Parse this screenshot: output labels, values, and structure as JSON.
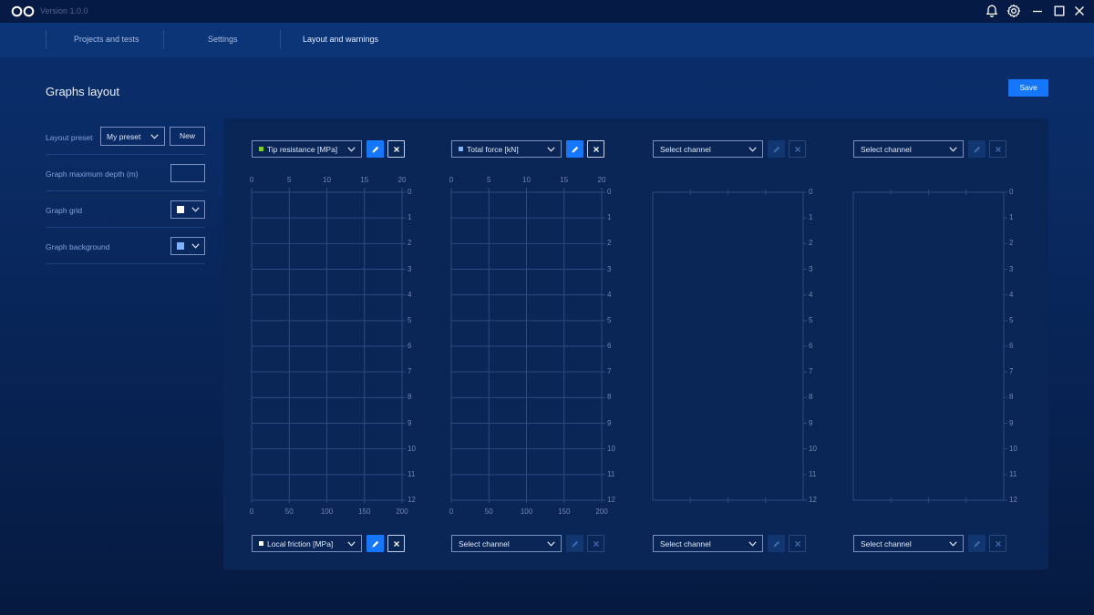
{
  "app": {
    "version": "Version 1.0.0"
  },
  "nav": {
    "items": [
      {
        "label": "Projects and tests"
      },
      {
        "label": "Settings"
      },
      {
        "label": "Layout and warnings"
      }
    ]
  },
  "page": {
    "title": "Graphs layout",
    "save_label": "Save"
  },
  "settings": {
    "layout_preset_label": "Layout preset",
    "layout_preset_value": "My preset",
    "new_label": "New",
    "max_depth_label": "Graph maximum depth (m)",
    "max_depth_value": "",
    "grid_label": "Graph grid",
    "grid_color": "#ffffff",
    "background_label": "Graph background",
    "background_color": "#7fb4ff"
  },
  "graphs": [
    {
      "top_channel": {
        "label": "Tip resistance [MPa]",
        "color": "#7ed321",
        "active": true
      },
      "top_ticks": [
        "0",
        "5",
        "10",
        "15",
        "20"
      ],
      "bottom_channel": {
        "label": "Local friction [MPa]",
        "color": "#ffffff",
        "active": true
      },
      "bottom_ticks": [
        "0",
        "50",
        "100",
        "150",
        "200"
      ],
      "depth_ticks": [
        "0",
        "1",
        "2",
        "3",
        "4",
        "5",
        "6",
        "7",
        "8",
        "9",
        "10",
        "11",
        "12"
      ]
    },
    {
      "top_channel": {
        "label": "Total force [kN]",
        "color": "#7fb4ff",
        "active": true
      },
      "top_ticks": [
        "0",
        "5",
        "10",
        "15",
        "20"
      ],
      "bottom_channel": {
        "label": "Select channel",
        "color": "",
        "active": false
      },
      "bottom_ticks": [
        "0",
        "50",
        "100",
        "150",
        "200"
      ],
      "depth_ticks": [
        "0",
        "1",
        "2",
        "3",
        "4",
        "5",
        "6",
        "7",
        "8",
        "9",
        "10",
        "11",
        "12"
      ]
    },
    {
      "top_channel": {
        "label": "Select channel",
        "color": "",
        "active": false
      },
      "top_ticks": [],
      "bottom_channel": {
        "label": "Select channel",
        "color": "",
        "active": false
      },
      "bottom_ticks": [],
      "depth_ticks": [
        "0",
        "1",
        "2",
        "3",
        "4",
        "5",
        "6",
        "7",
        "8",
        "9",
        "10",
        "11",
        "12"
      ]
    },
    {
      "top_channel": {
        "label": "Select channel",
        "color": "",
        "active": false
      },
      "top_ticks": [],
      "bottom_channel": {
        "label": "Select channel",
        "color": "",
        "active": false
      },
      "bottom_ticks": [],
      "depth_ticks": [
        "0",
        "1",
        "2",
        "3",
        "4",
        "5",
        "6",
        "7",
        "8",
        "9",
        "10",
        "11",
        "12"
      ]
    }
  ]
}
